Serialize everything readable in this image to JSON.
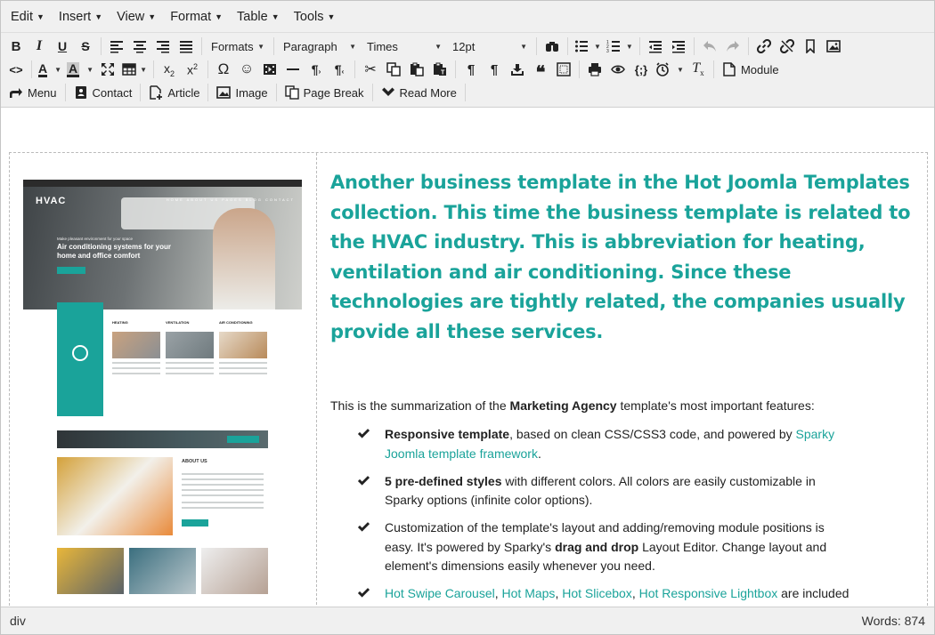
{
  "menubar": {
    "items": [
      {
        "label": "Edit"
      },
      {
        "label": "Insert"
      },
      {
        "label": "View"
      },
      {
        "label": "Format"
      },
      {
        "label": "Table"
      },
      {
        "label": "Tools"
      }
    ]
  },
  "toolbar": {
    "formats_label": "Formats",
    "block_format": "Paragraph",
    "font_family": "Times",
    "font_size": "12pt",
    "module_label": "Module",
    "menu_label": "Menu",
    "contact_label": "Contact",
    "article_label": "Article",
    "image_label": "Image",
    "pagebreak_label": "Page Break",
    "readmore_label": "Read More",
    "icon_names": [
      "bold-icon",
      "italic-icon",
      "underline-icon",
      "strikethrough-icon",
      "align-left-icon",
      "align-center-icon",
      "align-right-icon",
      "align-justify-icon",
      "find-replace-icon",
      "bullet-list-icon",
      "numbered-list-icon",
      "outdent-icon",
      "indent-icon",
      "undo-icon",
      "redo-icon",
      "link-icon",
      "unlink-icon",
      "anchor-icon",
      "image-icon",
      "source-code-icon",
      "text-color-icon",
      "background-color-icon",
      "fullscreen-icon",
      "table-icon",
      "subscript-icon",
      "superscript-icon",
      "special-char-icon",
      "emoticons-icon",
      "media-icon",
      "horizontal-rule-icon",
      "ltr-icon",
      "rtl-icon",
      "cut-icon",
      "copy-icon",
      "paste-icon",
      "paste-text-icon",
      "show-blocks-icon",
      "blockquote-icon",
      "template-icon",
      "print-icon",
      "preview-icon",
      "code-sample-icon",
      "insert-datetime-icon",
      "clear-formatting-icon"
    ]
  },
  "content": {
    "heading": "Another business template in the Hot Joomla Templates collection. This time the business template is related to the HVAC industry. This is abbreviation for heating, ventilation and air conditioning. Since these technologies are tightly related, the companies usually provide all these services.",
    "intro_pre": "This is the summarization of the ",
    "intro_bold": "Marketing Agency",
    "intro_post": " template's most important features:",
    "features": [
      {
        "bold": "Responsive template",
        "text": ", based on clean CSS/CSS3 code, and powered by ",
        "link": "Sparky Joomla template framework",
        "after": "."
      },
      {
        "bold": "5 pre-defined styles",
        "text": " with different colors. All colors are easily customizable in Sparky options (infinite color options)."
      },
      {
        "text1": "Customization of the template's layout and adding/removing module positions is easy. It's powered by Sparky's ",
        "bold": "drag and drop",
        "text2": " Layout Editor. Change layout and element's dimensions easily whenever you need."
      },
      {
        "links": [
          "Hot Swipe Carousel",
          "Hot Maps",
          "Hot Slicebox",
          "Hot Responsive Lightbox"
        ],
        "text": " are included"
      }
    ],
    "preview": {
      "logo": "HVAC",
      "hero_small": "Make pleasant environment for your space",
      "hero_big": "Air conditioning systems for your home and office comfort",
      "nav": "HOME ABOUT US PAGES BLOG CONTACT",
      "services": [
        "HEATING",
        "VENTILATION",
        "AIR CONDITIONING"
      ],
      "about_title": "ABOUT US"
    }
  },
  "statusbar": {
    "path": "div",
    "word_count": "Words: 874"
  },
  "colors": {
    "accent": "#1aa39a",
    "toolbar_bg": "#f0f0f0"
  }
}
